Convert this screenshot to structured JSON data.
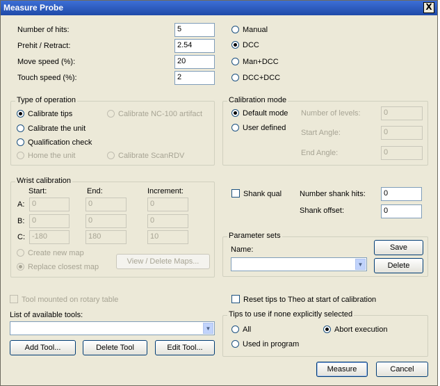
{
  "window": {
    "title": "Measure Probe",
    "close_glyph": "X"
  },
  "probe": {
    "hits_label": "Number of hits:",
    "hits_value": "5",
    "prehit_label": "Prehit / Retract:",
    "prehit_value": "2.54",
    "move_label": "Move speed (%):",
    "move_value": "20",
    "touch_label": "Touch speed (%):",
    "touch_value": "2"
  },
  "mode": {
    "manual": "Manual",
    "dcc": "DCC",
    "man_dcc": "Man+DCC",
    "dcc_dcc": "DCC+DCC",
    "selected": "DCC"
  },
  "operation": {
    "title": "Type of operation",
    "calibrate_tips": "Calibrate tips",
    "calibrate_unit": "Calibrate the unit",
    "qualification": "Qualification check",
    "home_unit": "Home the unit",
    "calibrate_nc100": "Calibrate NC-100 artifact",
    "calibrate_scanrdv": "Calibrate ScanRDV"
  },
  "calibration": {
    "title": "Calibration mode",
    "default_mode": "Default mode",
    "user_defined": "User defined",
    "levels_label": "Number of levels:",
    "levels_value": "0",
    "start_label": "Start Angle:",
    "start_value": "0",
    "end_label": "End Angle:",
    "end_value": "0"
  },
  "wrist": {
    "title": "Wrist calibration",
    "start_hdr": "Start:",
    "end_hdr": "End:",
    "inc_hdr": "Increment:",
    "row_a": "A:",
    "row_b": "B:",
    "row_c": "C:",
    "a_start": "0",
    "a_end": "0",
    "a_inc": "0",
    "b_start": "0",
    "b_end": "0",
    "b_inc": "0",
    "c_start": "-180",
    "c_end": "180",
    "c_inc": "10",
    "create_map": "Create new map",
    "replace_map": "Replace closest map",
    "view_maps": "View / Delete Maps..."
  },
  "shank": {
    "qual_label": "Shank qual",
    "hits_label": "Number shank hits:",
    "hits_value": "0",
    "offset_label": "Shank offset:",
    "offset_value": "0"
  },
  "params": {
    "title": "Parameter sets",
    "name_label": "Name:",
    "name_value": "",
    "save": "Save",
    "delete": "Delete"
  },
  "tools": {
    "rotary_label": "Tool mounted on rotary table",
    "list_label": "List of available tools:",
    "list_value": "",
    "add": "Add Tool...",
    "delete": "Delete Tool",
    "edit": "Edit Tool..."
  },
  "reset_tips": "Reset tips to Theo at start of calibration",
  "tips": {
    "title": "Tips to use if none explicitly selected",
    "all": "All",
    "used": "Used in program",
    "abort": "Abort execution"
  },
  "footer": {
    "measure": "Measure",
    "cancel": "Cancel"
  }
}
